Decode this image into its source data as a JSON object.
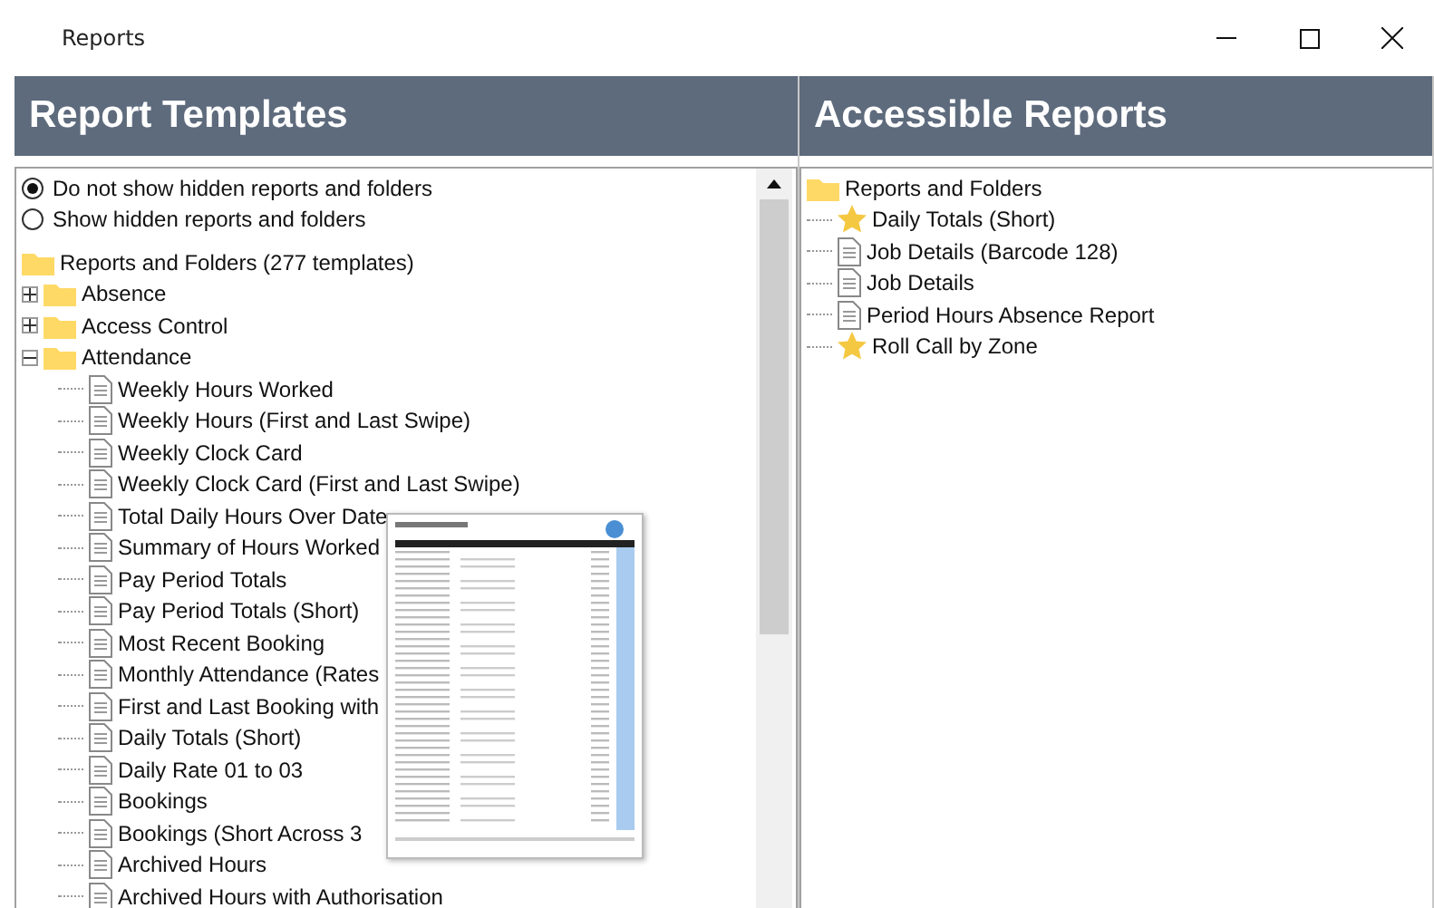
{
  "window": {
    "title": "Reports"
  },
  "templates_panel": {
    "title": "Report Templates",
    "visibility_options": [
      {
        "label": "Do not show hidden reports and folders",
        "selected": true
      },
      {
        "label": "Show hidden reports and folders",
        "selected": false
      }
    ],
    "tree": {
      "label": "Reports and Folders (277 templates)",
      "kind": "folder",
      "children": [
        {
          "label": "Absence",
          "kind": "folder",
          "expanded": false
        },
        {
          "label": "Access Control",
          "kind": "folder",
          "expanded": false
        },
        {
          "label": "Attendance",
          "kind": "folder",
          "expanded": true,
          "children": [
            {
              "label": "Weekly Hours Worked",
              "kind": "report"
            },
            {
              "label": "Weekly Hours (First and Last Swipe)",
              "kind": "report"
            },
            {
              "label": "Weekly Clock Card",
              "kind": "report"
            },
            {
              "label": "Weekly Clock Card (First and Last Swipe)",
              "kind": "report"
            },
            {
              "label": "Total Daily Hours Over Date",
              "kind": "report"
            },
            {
              "label": "Summary of Hours Worked",
              "kind": "report"
            },
            {
              "label": "Pay Period Totals",
              "kind": "report"
            },
            {
              "label": "Pay Period Totals (Short)",
              "kind": "report"
            },
            {
              "label": "Most Recent Booking",
              "kind": "report"
            },
            {
              "label": "Monthly Attendance (Rates",
              "kind": "report"
            },
            {
              "label": "First and Last Booking with",
              "kind": "report"
            },
            {
              "label": "Daily Totals (Short)",
              "kind": "report"
            },
            {
              "label": "Daily Rate 01 to 03",
              "kind": "report"
            },
            {
              "label": "Bookings",
              "kind": "report"
            },
            {
              "label": "Bookings (Short Across 3",
              "kind": "report"
            },
            {
              "label": "Archived Hours",
              "kind": "report"
            },
            {
              "label": "Archived Hours with Authorisation",
              "kind": "report"
            }
          ]
        }
      ]
    }
  },
  "accessible_panel": {
    "title": "Accessible Reports",
    "tree": {
      "label": "Reports and Folders",
      "kind": "folder",
      "children": [
        {
          "label": "Daily Totals (Short)",
          "kind": "favorite"
        },
        {
          "label": "Job Details (Barcode 128)",
          "kind": "report"
        },
        {
          "label": "Job Details",
          "kind": "report"
        },
        {
          "label": "Period Hours Absence Report",
          "kind": "report"
        },
        {
          "label": "Roll Call by Zone",
          "kind": "favorite"
        }
      ]
    }
  }
}
